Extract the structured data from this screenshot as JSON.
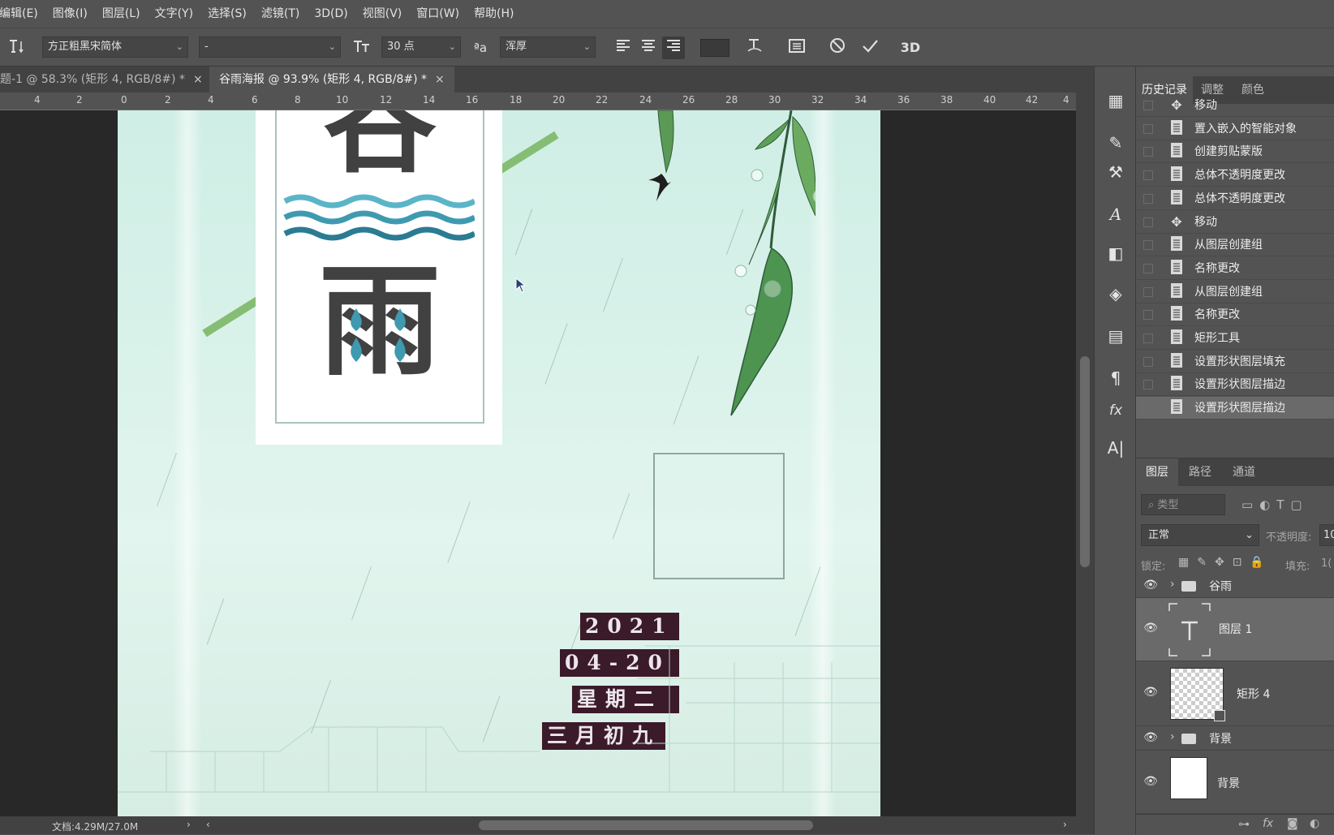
{
  "menubar": {
    "items": [
      "编辑(E)",
      "图像(I)",
      "图层(L)",
      "文字(Y)",
      "选择(S)",
      "滤镜(T)",
      "3D(D)",
      "视图(V)",
      "窗口(W)",
      "帮助(H)"
    ]
  },
  "options": {
    "font_family": "方正粗黑宋简体",
    "font_style": "-",
    "font_size": "30 点",
    "antialias": "浑厚",
    "tool_icon": "type-tool-icon",
    "label_3d": "3D"
  },
  "tabs": [
    {
      "label": "题-1 @ 58.3% (矩形 4, RGB/8#) *",
      "active": false
    },
    {
      "label": "谷雨海报 @ 93.9% (矩形 4, RGB/8#) *",
      "active": true
    }
  ],
  "ruler": {
    "labels": [
      "4",
      "2",
      "0",
      "2",
      "4",
      "6",
      "8",
      "10",
      "12",
      "14",
      "16",
      "18",
      "20",
      "22",
      "24",
      "26",
      "28",
      "30",
      "32",
      "34",
      "36",
      "38",
      "40",
      "42",
      "4"
    ]
  },
  "poster": {
    "char_top": "谷",
    "char_bottom": "雨",
    "dates": [
      "2021",
      "04-20",
      "星期二",
      "三月初九"
    ]
  },
  "status": {
    "doc_info": "文档:4.29M/27.0M"
  },
  "history_panel": {
    "tabs": [
      "历史记录",
      "调整",
      "颜色"
    ],
    "items": [
      {
        "label": "移动",
        "icon": "move-icon"
      },
      {
        "label": "置入嵌入的智能对象",
        "icon": "document-icon"
      },
      {
        "label": "创建剪贴蒙版",
        "icon": "document-icon"
      },
      {
        "label": "总体不透明度更改",
        "icon": "document-icon"
      },
      {
        "label": "总体不透明度更改",
        "icon": "document-icon"
      },
      {
        "label": "移动",
        "icon": "move-icon"
      },
      {
        "label": "从图层创建组",
        "icon": "document-icon"
      },
      {
        "label": "名称更改",
        "icon": "document-icon"
      },
      {
        "label": "从图层创建组",
        "icon": "document-icon"
      },
      {
        "label": "名称更改",
        "icon": "document-icon"
      },
      {
        "label": "矩形工具",
        "icon": "document-icon"
      },
      {
        "label": "设置形状图层填充",
        "icon": "document-icon"
      },
      {
        "label": "设置形状图层描边",
        "icon": "document-icon"
      },
      {
        "label": "设置形状图层描边",
        "icon": "document-icon"
      }
    ]
  },
  "layers_panel": {
    "tabs": [
      "图层",
      "路径",
      "通道"
    ],
    "filter_placeholder": "类型",
    "blend_mode": "正常",
    "opacity_label": "不透明度:",
    "opacity_value": "10",
    "lock_label": "锁定:",
    "fill_label": "填充:",
    "fill_value": "1(",
    "layers": [
      {
        "name": "谷雨",
        "type": "group"
      },
      {
        "name": "图层 1",
        "type": "text"
      },
      {
        "name": "矩形 4",
        "type": "shape"
      },
      {
        "name": "背景",
        "type": "group"
      },
      {
        "name": "背景",
        "type": "background"
      }
    ]
  },
  "colors": {
    "ui_bg": "#535353",
    "ui_dark": "#424242",
    "date_box": "#3b1a2a",
    "poster_green": "#86bd74",
    "char_color": "#414141"
  }
}
